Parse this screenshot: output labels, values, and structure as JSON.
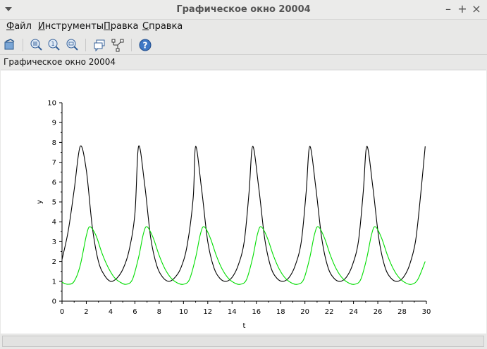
{
  "window": {
    "title": "Графическое окно 20004",
    "controls": [
      "minimize",
      "maximize",
      "close"
    ]
  },
  "menubar": {
    "items": [
      {
        "accel": "Ф",
        "rest": "айл"
      },
      {
        "accel": "И",
        "rest": "нструменты"
      },
      {
        "accel": "П",
        "rest": "равка"
      },
      {
        "accel": "С",
        "rest": "правка"
      }
    ]
  },
  "toolbar": {
    "buttons": [
      "rotate-icon",
      "zoom-grid-icon",
      "zoom-in-icon",
      "zoom-out-icon",
      "datatip-icon",
      "editor-icon",
      "help-icon"
    ]
  },
  "figure": {
    "name": "Графическое окно 20004"
  },
  "chart_data": {
    "type": "line",
    "xlabel": "t",
    "ylabel": "y",
    "xlim": [
      0,
      30
    ],
    "ylim": [
      0,
      10
    ],
    "xticks": [
      0,
      2,
      4,
      6,
      8,
      10,
      12,
      14,
      16,
      18,
      20,
      22,
      24,
      26,
      28,
      30
    ],
    "yticks": [
      0,
      1,
      2,
      3,
      4,
      5,
      6,
      7,
      8,
      9,
      10
    ],
    "grid": false,
    "series": [
      {
        "color": "#000000",
        "x": [
          0,
          0.5,
          1.0,
          1.5,
          2.0,
          2.5,
          3.0,
          3.5,
          4.0,
          4.5,
          5.0,
          5.5,
          6.0,
          6.3,
          6.8,
          7.3,
          7.8,
          8.3,
          8.8,
          9.3,
          9.8,
          10.3,
          10.8,
          11.0,
          11.5,
          12.0,
          12.5,
          13.0,
          13.5,
          14.0,
          14.5,
          15.0,
          15.4,
          15.7,
          16.2,
          16.7,
          17.2,
          17.7,
          18.2,
          18.7,
          19.2,
          19.7,
          20.1,
          20.4,
          20.9,
          21.4,
          21.9,
          22.4,
          22.9,
          23.4,
          23.9,
          24.4,
          24.8,
          25.1,
          25.6,
          26.1,
          26.6,
          27.1,
          27.6,
          28.1,
          28.6,
          29.1,
          29.5,
          29.9
        ],
        "y": [
          2.1,
          3.5,
          5.6,
          7.8,
          6.6,
          3.7,
          2.0,
          1.3,
          1.0,
          1.15,
          1.6,
          2.5,
          4.4,
          7.8,
          5.9,
          3.2,
          1.8,
          1.2,
          1.0,
          1.2,
          1.7,
          2.8,
          5.2,
          7.8,
          5.6,
          3.0,
          1.7,
          1.15,
          1.0,
          1.2,
          1.8,
          3.0,
          5.5,
          7.8,
          5.7,
          3.1,
          1.7,
          1.15,
          1.0,
          1.2,
          1.8,
          3.0,
          5.5,
          7.8,
          5.7,
          3.1,
          1.7,
          1.15,
          1.0,
          1.2,
          1.8,
          3.0,
          5.5,
          7.8,
          5.7,
          3.1,
          1.7,
          1.15,
          1.0,
          1.2,
          1.8,
          3.0,
          5.2,
          7.8
        ]
      },
      {
        "color": "#00dd00",
        "x": [
          0,
          0.5,
          1.0,
          1.5,
          2.0,
          2.3,
          2.8,
          3.3,
          3.8,
          4.3,
          4.8,
          5.3,
          5.8,
          6.3,
          6.7,
          7.0,
          7.5,
          8.0,
          8.5,
          9.0,
          9.5,
          10.0,
          10.5,
          11.0,
          11.4,
          11.7,
          12.2,
          12.7,
          13.2,
          13.7,
          14.2,
          14.7,
          15.2,
          15.7,
          16.1,
          16.4,
          16.9,
          17.4,
          17.9,
          18.4,
          18.9,
          19.4,
          19.9,
          20.4,
          20.8,
          21.1,
          21.6,
          22.1,
          22.6,
          23.1,
          23.6,
          24.1,
          24.6,
          25.1,
          25.5,
          25.8,
          26.3,
          26.8,
          27.3,
          27.8,
          28.3,
          28.8,
          29.3,
          29.9
        ],
        "y": [
          0.95,
          0.85,
          1.0,
          1.8,
          3.3,
          3.75,
          3.3,
          2.4,
          1.7,
          1.2,
          0.95,
          0.85,
          1.1,
          2.2,
          3.4,
          3.75,
          3.2,
          2.3,
          1.6,
          1.15,
          0.92,
          0.85,
          1.1,
          2.2,
          3.4,
          3.75,
          3.2,
          2.3,
          1.6,
          1.15,
          0.92,
          0.85,
          1.1,
          2.2,
          3.4,
          3.75,
          3.2,
          2.3,
          1.6,
          1.15,
          0.92,
          0.85,
          1.1,
          2.2,
          3.4,
          3.75,
          3.2,
          2.3,
          1.6,
          1.15,
          0.92,
          0.85,
          1.1,
          2.2,
          3.4,
          3.75,
          3.2,
          2.3,
          1.6,
          1.15,
          0.92,
          0.85,
          1.1,
          2.0
        ]
      }
    ]
  }
}
